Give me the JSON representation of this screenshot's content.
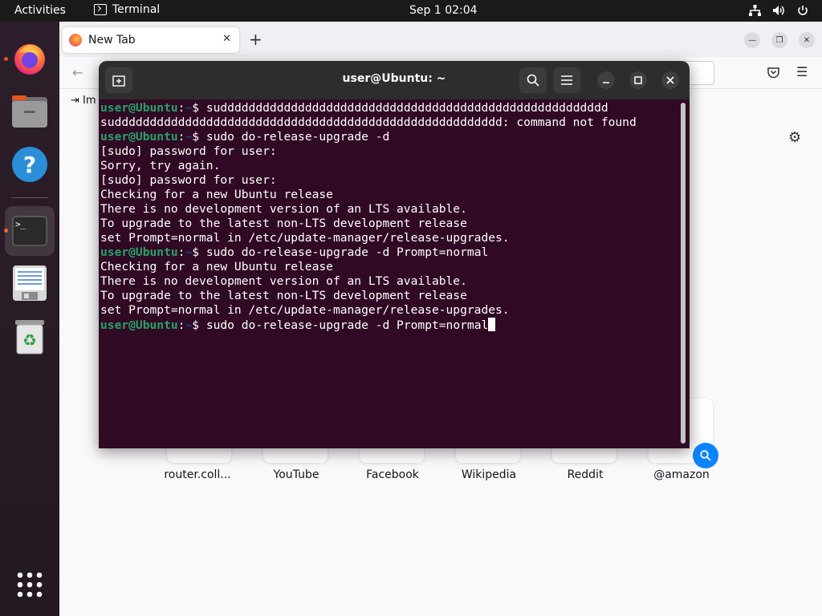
{
  "topbar": {
    "activities_label": "Activities",
    "app_name": "Terminal",
    "clock": "Sep 1  02:04"
  },
  "dock": {
    "items": [
      "firefox-icon",
      "files-icon",
      "help-icon",
      "terminal-icon",
      "text-editor-icon",
      "trash-icon",
      "app-grid-icon"
    ]
  },
  "firefox": {
    "tab_title": "New Tab",
    "bookmark_import_label": "Im",
    "shortcuts": [
      {
        "label": "router.coll..."
      },
      {
        "label": "YouTube"
      },
      {
        "label": "Facebook"
      },
      {
        "label": "Wikipedia"
      },
      {
        "label": "Reddit"
      },
      {
        "label": "@amazon"
      }
    ]
  },
  "terminal": {
    "title": "user@Ubuntu: ~",
    "prompt_user": "user@Ubuntu",
    "prompt_sep": ":",
    "prompt_path": "~",
    "prompt_dollar": "$ ",
    "lines": [
      {
        "type": "cmd",
        "text": "suddddddddddddddddddddddddddddddddddddddddddddddddddddddd"
      },
      {
        "type": "out",
        "text": "suddddddddddddddddddddddddddddddddddddddddddddddddddddddd: command not found"
      },
      {
        "type": "cmd",
        "text": "sudo do-release-upgrade -d"
      },
      {
        "type": "out",
        "text": "[sudo] password for user:"
      },
      {
        "type": "out",
        "text": "Sorry, try again."
      },
      {
        "type": "out",
        "text": "[sudo] password for user:"
      },
      {
        "type": "out",
        "text": "Checking for a new Ubuntu release"
      },
      {
        "type": "out",
        "text": "There is no development version of an LTS available."
      },
      {
        "type": "out",
        "text": "To upgrade to the latest non-LTS development release"
      },
      {
        "type": "out",
        "text": "set Prompt=normal in /etc/update-manager/release-upgrades."
      },
      {
        "type": "cmd",
        "text": "sudo do-release-upgrade -d Prompt=normal"
      },
      {
        "type": "out",
        "text": "Checking for a new Ubuntu release"
      },
      {
        "type": "out",
        "text": "There is no development version of an LTS available."
      },
      {
        "type": "out",
        "text": "To upgrade to the latest non-LTS development release"
      },
      {
        "type": "out",
        "text": "set Prompt=normal in /etc/update-manager/release-upgrades."
      },
      {
        "type": "cmd",
        "text": "sudo do-release-upgrade -d Prompt=normal",
        "cursor": true
      }
    ]
  },
  "colors": {
    "terminal_bg": "#300a24",
    "prompt_user": "#26a269",
    "prompt_path": "#12488b",
    "accent": "#e95420"
  }
}
